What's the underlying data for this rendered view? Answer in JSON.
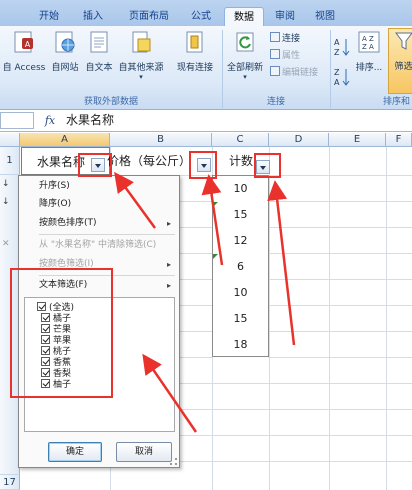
{
  "ribbon": {
    "tabs": [
      {
        "label": "开始"
      },
      {
        "label": "插入"
      },
      {
        "label": "页面布局"
      },
      {
        "label": "公式"
      },
      {
        "label": "数据"
      },
      {
        "label": "审阅"
      },
      {
        "label": "视图"
      }
    ],
    "active_tab": "数据",
    "groups": {
      "external_data": {
        "caption": "获取外部数据",
        "buttons": [
          {
            "label": "自 Access",
            "icon": "access-icon"
          },
          {
            "label": "自网站",
            "icon": "web-icon"
          },
          {
            "label": "自文本",
            "icon": "text-file-icon"
          },
          {
            "label": "自其他来源",
            "icon": "other-source-icon"
          },
          {
            "label": "现有连接",
            "icon": "connection-icon"
          }
        ]
      },
      "connections": {
        "caption": "连接",
        "refresh_label": "全部刷新",
        "small": [
          {
            "label": "连接"
          },
          {
            "label": "属性"
          },
          {
            "label": "编辑链接"
          }
        ]
      },
      "sort_filter": {
        "caption": "排序和",
        "sort_label": "排序...",
        "filter_label": "筛选"
      }
    }
  },
  "formula_bar": {
    "fx": "fx",
    "value": "水果名称"
  },
  "sheet": {
    "columns": [
      "A",
      "B",
      "C",
      "D",
      "E",
      "F"
    ],
    "rows": [
      "1",
      "17"
    ],
    "headers": {
      "fruit": "水果名称",
      "price": "价格（每公斤）",
      "count": "计数"
    },
    "counts": [
      "10",
      "15",
      "12",
      "6",
      "10",
      "15",
      "18"
    ]
  },
  "filter_menu": {
    "sort_asc": "升序(S)",
    "sort_desc": "降序(O)",
    "sort_by_color": "按颜色排序(T)",
    "clear_filter": "从 \"水果名称\" 中清除筛选(C)",
    "filter_by_color": "按颜色筛选(I)",
    "text_filter": "文本筛选(F)",
    "items": [
      "(全选)",
      "橘子",
      "芒果",
      "苹果",
      "桃子",
      "香蕉",
      "香梨",
      "柚子"
    ],
    "ok_label": "确定",
    "cancel_label": "取消"
  },
  "colors": {
    "annotation": "#e8322b",
    "ribbon_bg": "#dbe8f7"
  }
}
